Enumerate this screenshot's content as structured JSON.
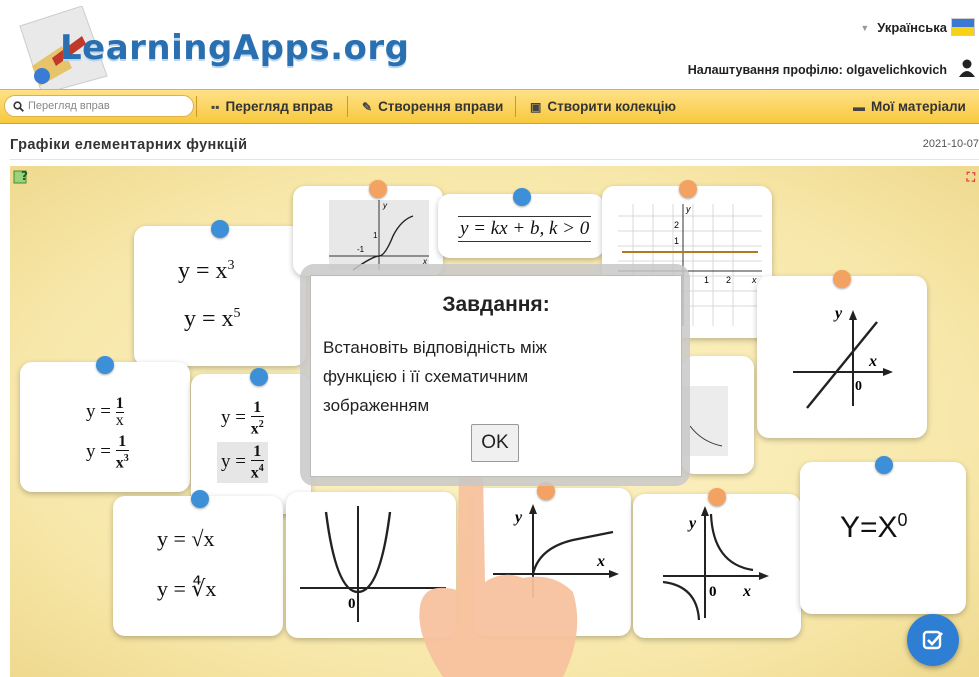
{
  "header": {
    "logo_text": "LearningApps.org",
    "language": "Українська",
    "profile": "Налаштування профілю: olgavelichkovich"
  },
  "toolbar": {
    "search_placeholder": "Перегляд вправ",
    "browse": "Перегляд вправ",
    "create": "Створення вправи",
    "collection": "Створити колекцію",
    "materials": "Мої матеріали"
  },
  "page": {
    "title": "Графіки елементарних функцій",
    "date": "2021-10-07"
  },
  "cards": {
    "cubic_1": "y = x",
    "cubic_1_exp": "3",
    "cubic_2": "y = x",
    "cubic_2_exp": "5",
    "linear": "y = kx + b, k > 0",
    "const_formula": "Y=X",
    "const_exp": "0",
    "recip_num": "1",
    "recip_den_1": "x",
    "recip_den_2": "x",
    "recip_den_2_exp": "3",
    "recip2_den_1": "x",
    "recip2_den_1_exp": "2",
    "recip2_den_2": "x",
    "recip2_den_2_exp": "4",
    "root_1": "y = √x",
    "root_2": "y = ∜x",
    "y_eq": "y =",
    "axis_y": "y",
    "axis_x": "x",
    "origin": "0",
    "tick_1": "1",
    "tick_2": "2",
    "tick_m1": "-1"
  },
  "modal": {
    "title": "Завдання:",
    "body": "Встановіть відповідність між функцією і її схематичним зображенням",
    "ok": "OK"
  },
  "colors": {
    "toolbar": "#f7c93f",
    "logo_blue": "#2a6fb0",
    "pin_blue": "#3d8fd8",
    "pin_orange": "#f4a261",
    "fab": "#2e7fd3"
  }
}
